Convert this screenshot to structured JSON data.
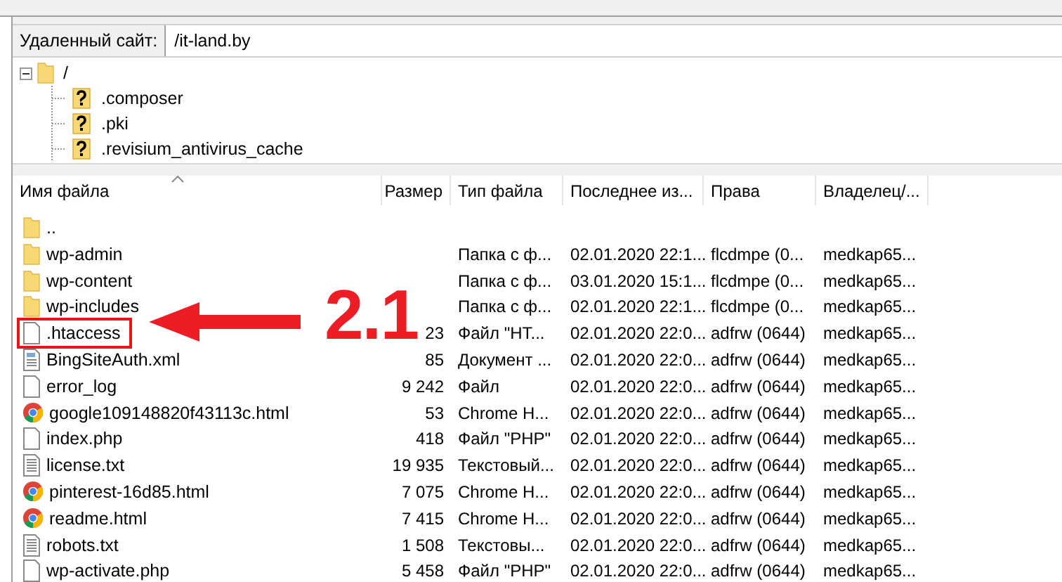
{
  "address": {
    "label": "Удаленный сайт:",
    "value": "/it-land.by"
  },
  "tree": [
    {
      "name": "/",
      "kind": "folder",
      "expanded": true,
      "children": [
        {
          "name": ".composer",
          "kind": "unknown"
        },
        {
          "name": ".pki",
          "kind": "unknown"
        },
        {
          "name": ".revisium_antivirus_cache",
          "kind": "unknown"
        }
      ]
    }
  ],
  "table": {
    "columns": [
      "Имя файла",
      "Размер",
      "Тип файла",
      "Последнее из...",
      "Права",
      "Владелец/..."
    ],
    "rows": [
      {
        "kind": "folder",
        "highlighted": false,
        "cells": [
          "..",
          "",
          "",
          "",
          "",
          ""
        ]
      },
      {
        "kind": "folder",
        "highlighted": false,
        "cells": [
          "wp-admin",
          "",
          "Папка с ф...",
          "02.01.2020 22:1...",
          "flcdmpe (0...",
          "medkap65..."
        ]
      },
      {
        "kind": "folder",
        "highlighted": false,
        "cells": [
          "wp-content",
          "",
          "Папка с ф...",
          "03.01.2020 15:1...",
          "flcdmpe (0...",
          "medkap65..."
        ]
      },
      {
        "kind": "folder",
        "highlighted": false,
        "cells": [
          "wp-includes",
          "",
          "Папка с ф...",
          "02.01.2020 22:1...",
          "flcdmpe (0...",
          "medkap65..."
        ]
      },
      {
        "kind": "file",
        "highlighted": true,
        "cells": [
          ".htaccess",
          "23",
          "Файл \"HT...",
          "02.01.2020 22:0...",
          "adfrw (0644)",
          "medkap65..."
        ]
      },
      {
        "kind": "xml",
        "highlighted": false,
        "cells": [
          "BingSiteAuth.xml",
          "85",
          "Документ ...",
          "02.01.2020 22:0...",
          "adfrw (0644)",
          "medkap65..."
        ]
      },
      {
        "kind": "file",
        "highlighted": false,
        "cells": [
          "error_log",
          "9 242",
          "Файл",
          "02.01.2020 22:0...",
          "adfrw (0644)",
          "medkap65..."
        ]
      },
      {
        "kind": "chrome",
        "highlighted": false,
        "cells": [
          "google109148820f43113c.html",
          "53",
          "Chrome H...",
          "02.01.2020 22:0...",
          "adfrw (0644)",
          "medkap65..."
        ]
      },
      {
        "kind": "file",
        "highlighted": false,
        "cells": [
          "index.php",
          "418",
          "Файл \"PHP\"",
          "02.01.2020 22:0...",
          "adfrw (0644)",
          "medkap65..."
        ]
      },
      {
        "kind": "text",
        "highlighted": false,
        "cells": [
          "license.txt",
          "19 935",
          "Текстовый...",
          "02.01.2020 22:0...",
          "adfrw (0644)",
          "medkap65..."
        ]
      },
      {
        "kind": "chrome",
        "highlighted": false,
        "cells": [
          "pinterest-16d85.html",
          "7 075",
          "Chrome H...",
          "02.01.2020 22:0...",
          "adfrw (0644)",
          "medkap65..."
        ]
      },
      {
        "kind": "chrome",
        "highlighted": false,
        "cells": [
          "readme.html",
          "7 415",
          "Chrome H...",
          "02.01.2020 22:0...",
          "adfrw (0644)",
          "medkap65..."
        ]
      },
      {
        "kind": "text",
        "highlighted": false,
        "cells": [
          "robots.txt",
          "1 508",
          "Текстовы...",
          "02.01.2020 22:0...",
          "adfrw (0644)",
          "medkap65..."
        ]
      },
      {
        "kind": "file",
        "highlighted": false,
        "cells": [
          "wp-activate.php",
          "5 458",
          "Файл \"PHP\"",
          "02.01.2020 22:0...",
          "adfrw (0644)",
          "medkap65..."
        ]
      }
    ]
  },
  "annotation": {
    "label": "2.1"
  }
}
